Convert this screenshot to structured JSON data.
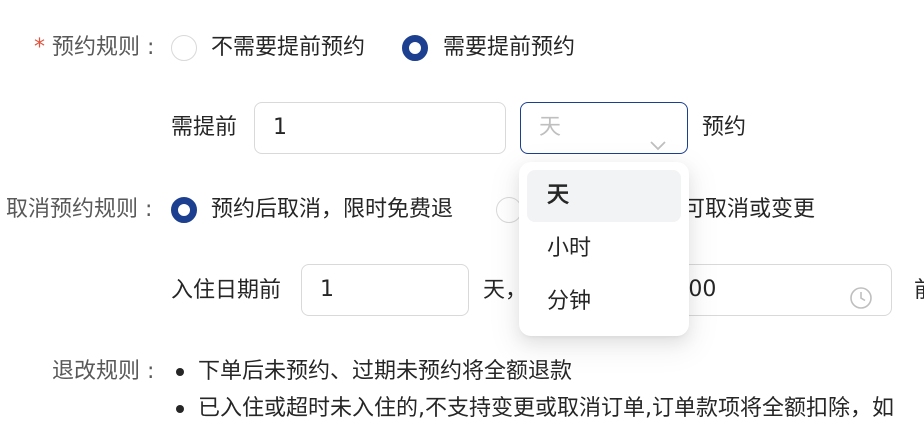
{
  "booking_rule": {
    "star": "*",
    "label": "预约规则 :",
    "options": [
      "不需要提前预约",
      "需要提前预约"
    ],
    "selected_index": 1,
    "advance_prefix": "需提前",
    "advance_value": "1",
    "unit_select_value": "天",
    "advance_suffix": "预约"
  },
  "unit_dropdown": {
    "options": [
      "天",
      "小时",
      "分钟"
    ],
    "active_index": 0
  },
  "cancel_rule": {
    "label": "取消预约规则 :",
    "option_1": "预约后取消，限时免费退",
    "option_2_partial": "可取消或变更",
    "checkin_prefix": "入住日期前",
    "days_value": "1",
    "days_unit": "天，",
    "time_partial": ":00",
    "trailing_char": "前"
  },
  "refund_rule": {
    "label": "退改规则 :",
    "items": [
      "下单后未预约、过期未预约将全额退款",
      "已入住或超时未入住的,不支持变更或取消订单,订单款项将全额扣除，如"
    ]
  },
  "colors": {
    "primary": "#1d3f8f",
    "required": "#e0533f",
    "border": "#d9d9d9",
    "placeholder": "#bfbfbf"
  }
}
